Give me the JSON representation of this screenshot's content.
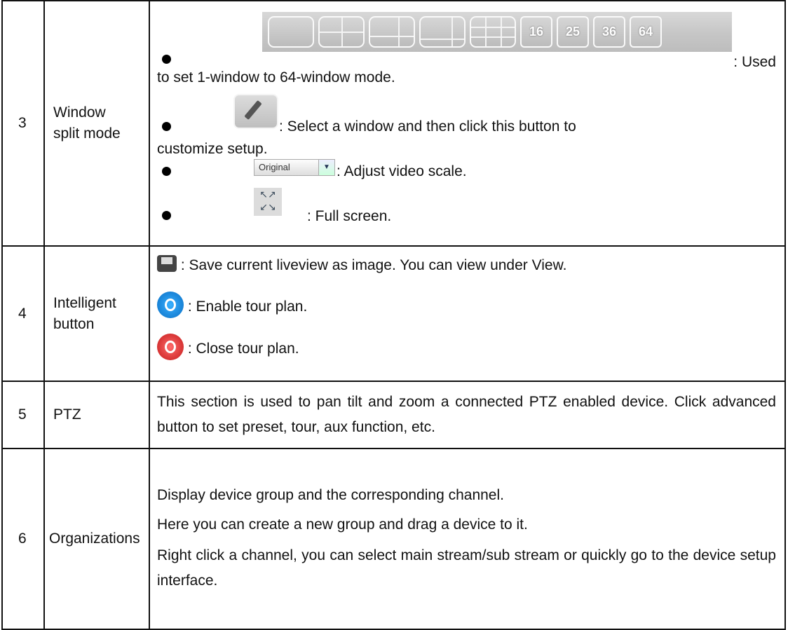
{
  "rows": [
    {
      "num": "3",
      "title_lines": [
        "Window",
        "split mode"
      ],
      "layout_buttons": [
        "",
        "",
        "",
        "",
        "",
        "16",
        "25",
        "36",
        "64"
      ],
      "bullets": [
        {
          "text1": ": Used",
          "text2": "to set 1-window to 64-window mode."
        },
        {
          "text1": ": Select a window and then click this button to",
          "text2": "customize setup."
        },
        {
          "text1": ": Adjust video scale.",
          "select_label": "Original",
          "select_arrow": "▼"
        },
        {
          "text1": ": Full screen.",
          "fs_glyph": "↖↗\n↙↘"
        }
      ]
    },
    {
      "num": "4",
      "title_lines": [
        "Intelligent",
        "button"
      ],
      "items": [
        ": Save current liveview as image. You can view under View.",
        ": Enable tour plan.",
        ": Close tour plan."
      ]
    },
    {
      "num": "5",
      "title": "PTZ",
      "desc": "This section is used to pan tilt and zoom a connected PTZ enabled device.  Click advanced button to set preset, tour, aux function, etc."
    },
    {
      "num": "6",
      "title": "Organizations",
      "paras": [
        "Display device group and the corresponding channel.",
        "Here you can create a new group and drag a device to it.",
        "Right click a channel, you can select main stream/sub stream or quickly go to the device setup interface."
      ]
    }
  ]
}
